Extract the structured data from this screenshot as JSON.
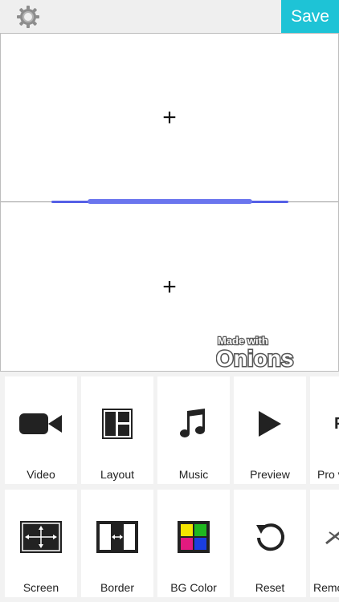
{
  "header": {
    "save_label": "Save",
    "settings_icon": "gear-icon"
  },
  "canvas": {
    "top_pane_placeholder": "+",
    "bottom_pane_placeholder": "+",
    "watermark_line1": "Made with",
    "watermark_line2": "Onions"
  },
  "tools": {
    "row1": [
      {
        "label": "Video",
        "icon": "video-camera-icon"
      },
      {
        "label": "Layout",
        "icon": "layout-icon"
      },
      {
        "label": "Music",
        "icon": "music-note-icon"
      },
      {
        "label": "Preview",
        "icon": "play-icon"
      },
      {
        "label": "Pro v",
        "icon": "pro-icon"
      }
    ],
    "row2": [
      {
        "label": "Screen",
        "icon": "screen-expand-icon"
      },
      {
        "label": "Border",
        "icon": "border-icon"
      },
      {
        "label": "BG Color",
        "icon": "color-grid-icon"
      },
      {
        "label": "Reset",
        "icon": "reset-icon"
      },
      {
        "label": "Remo",
        "icon": "remove-watermark-icon"
      }
    ]
  },
  "colors": {
    "accent": "#1ec3d6",
    "divider_handle": "#5560e6",
    "bg_color_swatches": [
      "#f4e400",
      "#1fb81f",
      "#e21a7f",
      "#1a3ee0"
    ]
  }
}
